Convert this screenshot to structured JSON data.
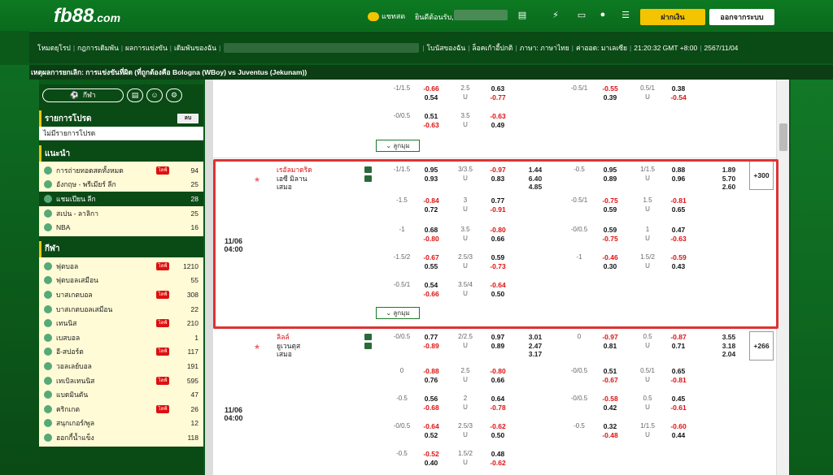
{
  "brand": {
    "name": "fb88",
    "suffix": ".com"
  },
  "header": {
    "chat_label": "แชทสด",
    "welcome": "ยินดีต้อนรับ,",
    "deposit_button": "ฝากเงิน",
    "logout_button": "ออกจากระบบ"
  },
  "nav": {
    "items": [
      "โหมดยุโรป",
      "กฎการเดิมพัน",
      "ผลการแข่งขัน",
      "เดิมพันของฉัน"
    ],
    "right_items": [
      "โบนัสของฉัน",
      "ล็อคเก้าอี้ปกติ",
      "ภาษา: ภาษาไทย",
      "ค่าออด: มาเลเซีย",
      "21:20:32 GMT +8:00",
      "2567/11/04"
    ]
  },
  "ticker": "เหตุผลการยกเลิก: การแข่งขันที่ผิด (ที่ถูกต้องคือ Bologna (WBoy) vs Juventus (Jekunam))",
  "sidebar": {
    "main_button": "กีฬา",
    "sections": [
      {
        "title": "รายการโปรด",
        "toggle": "ลบ",
        "items": [
          {
            "label": "ไม่มีรายการโปรด"
          }
        ]
      },
      {
        "title": "แนะนำ",
        "items": [
          {
            "label": "การถ่ายทอดสดทั้งหมด",
            "count": "94",
            "live": true
          },
          {
            "label": "อังกฤษ - พรีเมียร์ ลีก",
            "count": "25"
          },
          {
            "label": "แชมเปียน ลีก",
            "count": "28",
            "active": true
          },
          {
            "label": "สเปน - ลาลิกา",
            "count": "25"
          },
          {
            "label": "NBA",
            "count": "16"
          }
        ]
      },
      {
        "title": "กีฬา",
        "items": [
          {
            "label": "ฟุตบอล",
            "count": "1210",
            "live": true
          },
          {
            "label": "ฟุตบอลเสมือน",
            "count": "55"
          },
          {
            "label": "บาสเกตบอล",
            "count": "308",
            "live": true
          },
          {
            "label": "บาสเกตบอลเสมือน",
            "count": "22"
          },
          {
            "label": "เทนนิส",
            "count": "210",
            "live": true
          },
          {
            "label": "เบสบอล",
            "count": "1"
          },
          {
            "label": "อี-สปอร์ต",
            "count": "117",
            "live": true
          },
          {
            "label": "วอลเลย์บอล",
            "count": "191"
          },
          {
            "label": "เทเบิลเทนนิส",
            "count": "595",
            "live": true
          },
          {
            "label": "แบดมินตัน",
            "count": "47"
          },
          {
            "label": "คริกเกต",
            "count": "26",
            "live": true
          },
          {
            "label": "สนุกเกอร์/พูล",
            "count": "12"
          },
          {
            "label": "ฮอกกี้น้ำแข็ง",
            "count": "118"
          }
        ]
      }
    ],
    "live_badge": "ไลฟ์"
  },
  "more_label": "ลูกมุม",
  "matches": [
    {
      "date": "11/06",
      "time": "04:00",
      "home": "เรอัลมาดริด",
      "away": "เอซี มิลาน",
      "draw": "เสมอ",
      "plus": "+300"
    },
    {
      "date": "11/06",
      "time": "04:00",
      "home": "ลิลล์",
      "away": "ยูเวนตุส",
      "draw": "เสมอ",
      "plus": "+266"
    }
  ],
  "colors": {
    "brand_green": "#0a4a15",
    "accent_yellow": "#f5c400",
    "negative_red": "#d11111",
    "highlight_red": "#dd3333"
  }
}
